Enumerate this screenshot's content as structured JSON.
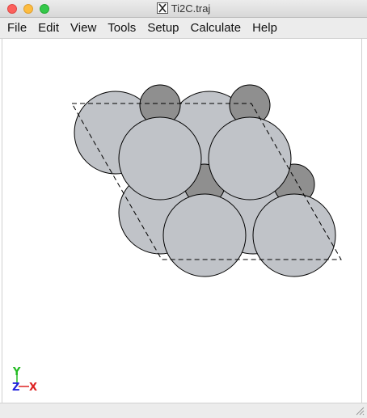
{
  "window": {
    "title": "Ti2C.traj"
  },
  "menu": {
    "items": [
      "File",
      "Edit",
      "View",
      "Tools",
      "Setup",
      "Calculate",
      "Help"
    ]
  },
  "axes": {
    "y_label": "Y",
    "z_label": "Z",
    "x_label": "X",
    "y_color": "#22bb22",
    "z_color": "#2222dd",
    "x_color": "#dd2222"
  },
  "colors": {
    "titanium": "#c0c3c8",
    "carbon": "#8f8f8f",
    "outline": "#000000",
    "cell": "#000000"
  },
  "icons": {
    "title_icon": "x11-icon",
    "resize": "resize-grip-icon"
  }
}
